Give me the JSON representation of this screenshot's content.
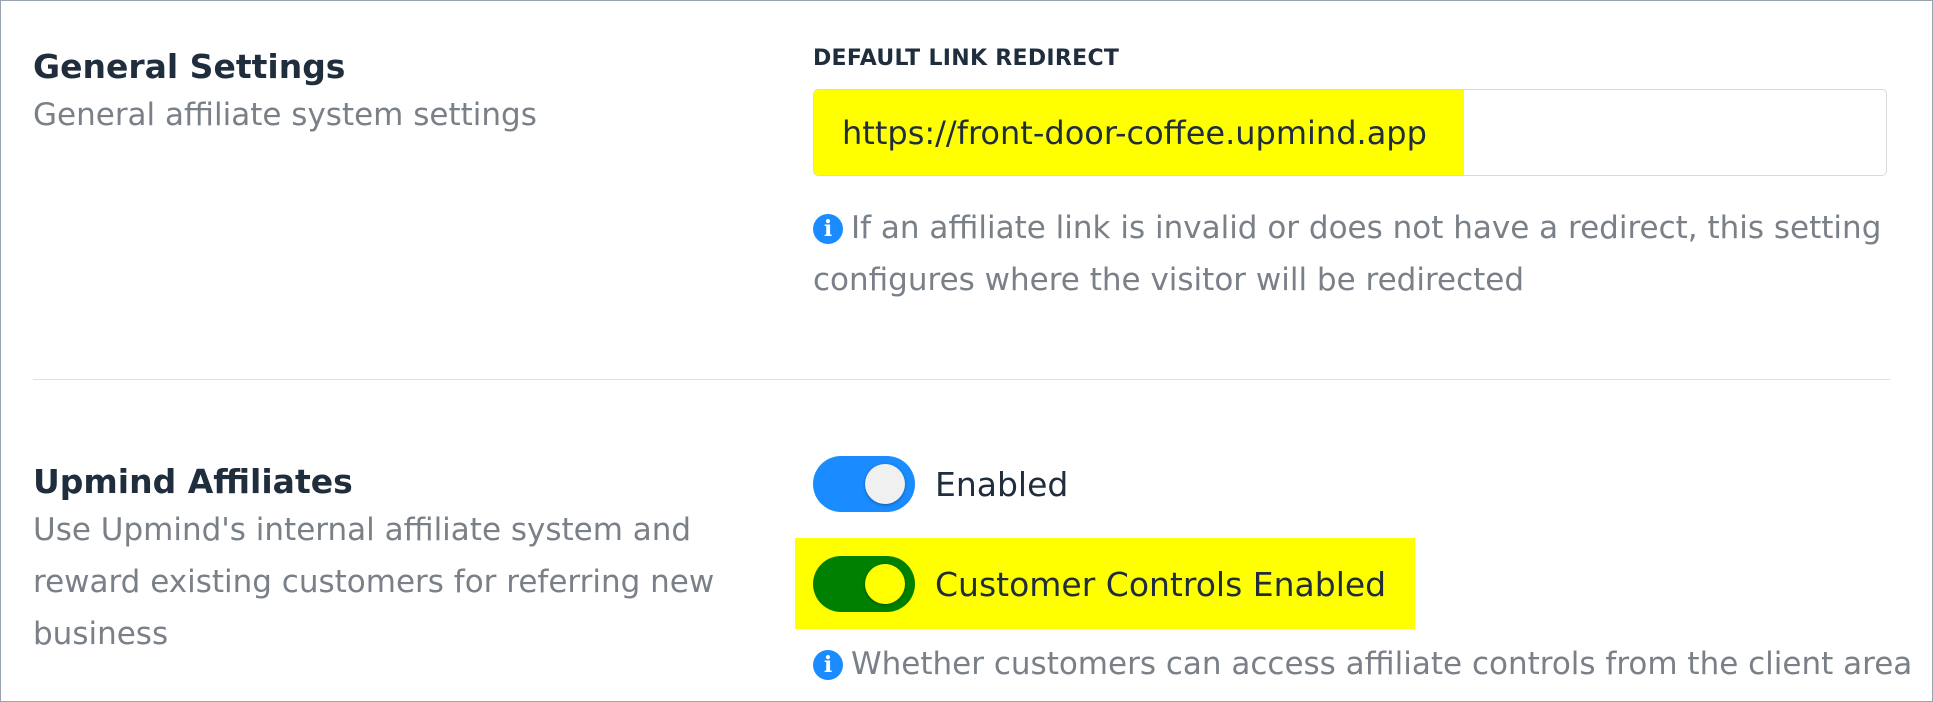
{
  "general": {
    "title": "General Settings",
    "description": "General affiliate system settings",
    "field_label": "DEFAULT LINK REDIRECT",
    "redirect_value": "https://front-door-coffee.upmind.app",
    "help_icon": "info-icon",
    "help_text": "If an affiliate link is invalid or does not have a redirect, this setting configures where the visitor will be redirected"
  },
  "affiliates": {
    "title": "Upmind Affiliates",
    "description": "Use Upmind's internal affiliate system and reward existing customers for referring new business",
    "toggle_enabled": {
      "label": "Enabled",
      "on": true,
      "track_color": "#1a8cff",
      "knob_color": "#f0f0f0"
    },
    "toggle_customer_controls": {
      "label": "Customer Controls Enabled",
      "on": true,
      "track_color": "#008000",
      "knob_color": "#ffff00",
      "highlighted": true
    },
    "help_icon": "info-icon",
    "help_text": "Whether customers can access affiliate controls from the client area"
  },
  "colors": {
    "highlight": "#ffff00",
    "info_blue": "#1a8cff",
    "text_dark": "#1f2d3d",
    "text_muted": "#7a8088"
  }
}
